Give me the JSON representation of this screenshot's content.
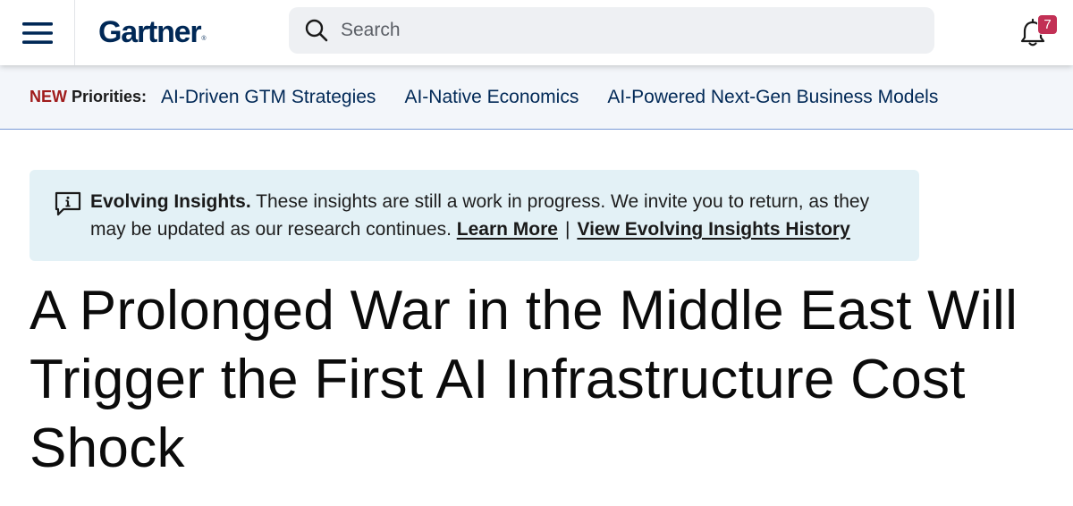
{
  "header": {
    "menu_icon": "hamburger-menu-icon",
    "logo_text": "Gartner",
    "logo_mark": "®",
    "search": {
      "placeholder": "Search",
      "value": ""
    },
    "notifications": {
      "icon": "bell-icon",
      "count": "7"
    }
  },
  "priorities": {
    "new_label": "NEW",
    "label": "Priorities:",
    "links": [
      "AI-Driven GTM Strategies",
      "AI-Native Economics",
      "AI-Powered Next-Gen Business Models"
    ]
  },
  "insights": {
    "icon": "info-comment-icon",
    "heading": "Evolving Insights.",
    "body": "These insights are still a work in progress. We invite you to return, as they may be updated as our research continues.",
    "learn_more": "Learn More",
    "separator": "|",
    "history_link": "View Evolving Insights History"
  },
  "article": {
    "title": "A Prolonged War in the Middle East Will Trigger the First AI Infrastructure Cost Shock"
  },
  "colors": {
    "brand_navy": "#002856",
    "new_red": "#a01c1c",
    "badge": "#c23055",
    "priorities_bg": "#f3f6fa",
    "insights_bg": "#e3f1f6",
    "search_bg": "#eef0f3"
  }
}
